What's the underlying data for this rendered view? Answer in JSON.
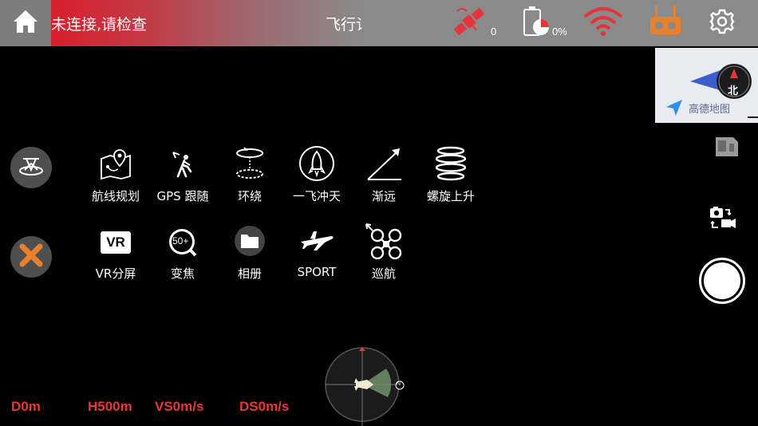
{
  "topbar": {
    "status_message": "未连接,请检查",
    "flight_label": "飞行记",
    "satellite_count": "0",
    "battery_percent": "0%",
    "icons": [
      "home-icon",
      "satellite-icon",
      "battery-icon",
      "wifi-icon",
      "remote-controller-icon",
      "gear-icon"
    ]
  },
  "map": {
    "brand": "高德地图",
    "compass_label": "北"
  },
  "modes": {
    "row1": [
      {
        "label": "航线规划",
        "icon": "waypoint-map-icon"
      },
      {
        "label": "GPS 跟随",
        "icon": "gps-follow-icon"
      },
      {
        "label": "环绕",
        "icon": "orbit-icon"
      },
      {
        "label": "一飞冲天",
        "icon": "rocket-icon"
      },
      {
        "label": "渐远",
        "icon": "dronie-arrow-icon"
      },
      {
        "label": "螺旋上升",
        "icon": "spiral-icon"
      }
    ],
    "row2": [
      {
        "label": "VR分屏",
        "icon": "vr-icon",
        "badge": "VR"
      },
      {
        "label": "变焦",
        "icon": "zoom-icon",
        "badge": "50+"
      },
      {
        "label": "相册",
        "icon": "album-folder-icon"
      },
      {
        "label": "SPORT",
        "icon": "airplane-icon"
      },
      {
        "label": "巡航",
        "icon": "cruise-drone-icon"
      }
    ]
  },
  "telemetry": {
    "distance": "D0m",
    "height": "H500m",
    "vertical_speed": "VS0m/s",
    "horizontal_speed": "DS0m/s"
  },
  "radar": {
    "north_label": "N"
  },
  "colors": {
    "accent_red": "#e53935",
    "controller_orange": "#e8812d",
    "wifi_red": "#e4343c"
  }
}
